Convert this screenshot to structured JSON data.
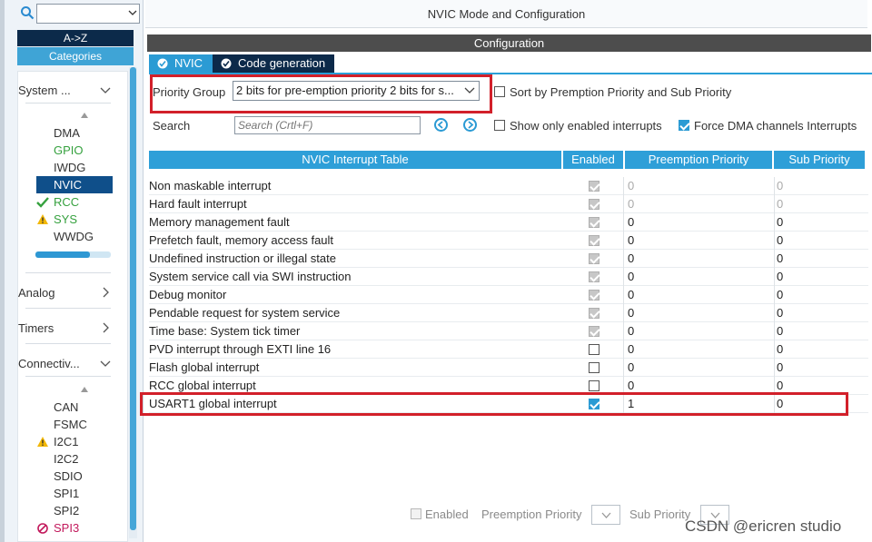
{
  "sidebar": {
    "az_label": "A->Z",
    "categories_label": "Categories",
    "system_core": {
      "label": "System ...",
      "items": [
        {
          "label": "DMA",
          "state": "normal"
        },
        {
          "label": "GPIO",
          "state": "green"
        },
        {
          "label": "IWDG",
          "state": "normal"
        },
        {
          "label": "NVIC",
          "state": "selected"
        },
        {
          "label": "RCC",
          "state": "green-check"
        },
        {
          "label": "SYS",
          "state": "warning"
        },
        {
          "label": "WWDG",
          "state": "normal"
        }
      ]
    },
    "analog_label": "Analog",
    "timers_label": "Timers",
    "connectivity": {
      "label": "Connectiv...",
      "items": [
        {
          "label": "CAN",
          "state": "normal"
        },
        {
          "label": "FSMC",
          "state": "normal"
        },
        {
          "label": "I2C1",
          "state": "warning"
        },
        {
          "label": "I2C2",
          "state": "normal"
        },
        {
          "label": "SDIO",
          "state": "normal"
        },
        {
          "label": "SPI1",
          "state": "normal"
        },
        {
          "label": "SPI2",
          "state": "normal"
        },
        {
          "label": "SPI3",
          "state": "disabled"
        }
      ]
    }
  },
  "main": {
    "title": "NVIC Mode and Configuration",
    "configuration_label": "Configuration",
    "tabs": [
      {
        "label": "NVIC",
        "active": false
      },
      {
        "label": "Code generation",
        "active": true
      }
    ],
    "priority_group_label": "Priority Group",
    "priority_group_value": "2 bits for pre-emption priority 2 bits for s...",
    "sort_label": "Sort by Premption Priority and Sub Priority",
    "search_label": "Search",
    "search_placeholder": "Search (Crtl+F)",
    "show_enabled_label": "Show only enabled interrupts",
    "force_dma_label": "Force DMA channels Interrupts",
    "table": {
      "headers": [
        "NVIC Interrupt Table",
        "Enabled",
        "Preemption Priority",
        "Sub Priority"
      ],
      "rows": [
        {
          "name": "Non maskable interrupt",
          "enabled": "locked",
          "pre": "0",
          "sub": "0",
          "muted": true
        },
        {
          "name": "Hard fault interrupt",
          "enabled": "locked",
          "pre": "0",
          "sub": "0",
          "muted": true
        },
        {
          "name": "Memory management fault",
          "enabled": "locked",
          "pre": "0",
          "sub": "0",
          "muted": false
        },
        {
          "name": "Prefetch fault, memory access fault",
          "enabled": "locked",
          "pre": "0",
          "sub": "0",
          "muted": false
        },
        {
          "name": "Undefined instruction or illegal state",
          "enabled": "locked",
          "pre": "0",
          "sub": "0",
          "muted": false
        },
        {
          "name": "System service call via SWI instruction",
          "enabled": "locked",
          "pre": "0",
          "sub": "0",
          "muted": false
        },
        {
          "name": "Debug monitor",
          "enabled": "locked",
          "pre": "0",
          "sub": "0",
          "muted": false
        },
        {
          "name": "Pendable request for system service",
          "enabled": "locked",
          "pre": "0",
          "sub": "0",
          "muted": false
        },
        {
          "name": "Time base: System tick timer",
          "enabled": "locked",
          "pre": "0",
          "sub": "0",
          "muted": false
        },
        {
          "name": "PVD interrupt through EXTI line 16",
          "enabled": "off",
          "pre": "0",
          "sub": "0",
          "muted": false
        },
        {
          "name": "Flash global interrupt",
          "enabled": "off",
          "pre": "0",
          "sub": "0",
          "muted": false
        },
        {
          "name": "RCC global interrupt",
          "enabled": "off",
          "pre": "0",
          "sub": "0",
          "muted": false
        },
        {
          "name": "USART1 global interrupt",
          "enabled": "on",
          "pre": "1",
          "sub": "0",
          "muted": false
        }
      ]
    },
    "footer": {
      "enabled_label": "Enabled",
      "preemption_label": "Preemption Priority",
      "sub_label": "Sub Priority"
    },
    "watermark": "CSDN @ericren studio"
  },
  "colors": {
    "accent": "#2e9fd8",
    "dark": "#0c2a4a",
    "highlight_red": "#d2202a",
    "green": "#35a13e",
    "warning": "#f2b705"
  }
}
